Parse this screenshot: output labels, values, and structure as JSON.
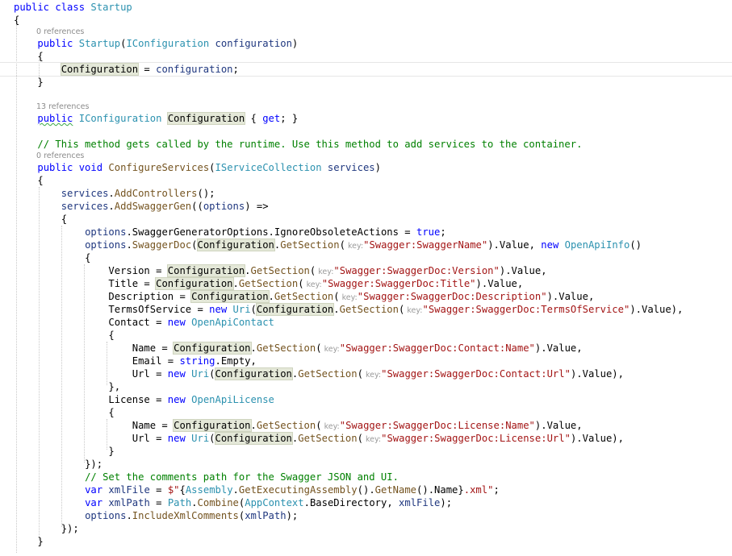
{
  "codelens": {
    "ctor_refs": "0 references",
    "prop_refs": "13 references",
    "method_refs": "0 references"
  },
  "code": {
    "l1_kw": "public class ",
    "l1_type": "Startup",
    "l2": "{",
    "l3_kw": "public ",
    "l3_type": "Startup",
    "l3_p1": "(",
    "l3_ptype": "IConfiguration",
    "l3_pname": " configuration",
    "l3_p2": ")",
    "l4": "{",
    "l5_prop": "Configuration",
    "l5_eq": " = ",
    "l5_var": "configuration",
    "l5_end": ";",
    "l6": "}",
    "l7_kw1": "public",
    "l7_sp": " ",
    "l7_type": "IConfiguration",
    "l7_sp2": " ",
    "l7_prop": "Configuration",
    "l7_b1": " { ",
    "l7_get": "get",
    "l7_b2": "; }",
    "l8_comment": "// This method gets called by the runtime. Use this method to add services to the container.",
    "l9_kw": "public void ",
    "l9_fn": "ConfigureServices",
    "l9_p1": "(",
    "l9_ptype": "IServiceCollection",
    "l9_pname": " services",
    "l9_p2": ")",
    "l10": "{",
    "l11_var": "services",
    "l11_dot": ".",
    "l11_fn": "AddControllers",
    "l11_end": "();",
    "l12_var": "services",
    "l12_dot": ".",
    "l12_fn": "AddSwaggerGen",
    "l12_p": "((",
    "l12_param": "options",
    "l12_end": ") =>",
    "l13": "{",
    "l14_var": "options",
    "l14_a": ".SwaggerGeneratorOptions.IgnoreObsoleteActions = ",
    "l14_true": "true",
    "l14_end": ";",
    "l15_var": "options",
    "l15_dot": ".",
    "l15_fn": "SwaggerDoc",
    "l15_p": "(",
    "l15_prop": "Configuration",
    "l15_dot2": ".",
    "l15_gs": "GetSection",
    "l15_p2": "(",
    "l15_hint": " key:",
    "l15_str": "\"Swagger:SwaggerName\"",
    "l15_mid": ").Value, ",
    "l15_new": "new ",
    "l15_type": "OpenApiInfo",
    "l15_end": "()",
    "l16": "{",
    "l17_a": "Version = ",
    "l17_str": "\"Swagger:SwaggerDoc:Version\"",
    "l18_a": "Title = ",
    "l18_str": "\"Swagger:SwaggerDoc:Title\"",
    "l19_a": "Description = ",
    "l19_str": "\"Swagger:SwaggerDoc:Description\"",
    "l20_a": "TermsOfService = ",
    "l20_uri": "Uri",
    "l20_str": "\"Swagger:SwaggerDoc:TermsOfService\"",
    "l20_end": ").Value),",
    "l21_a": "Contact = ",
    "l21_type": "OpenApiContact",
    "l22": "{",
    "l23_a": "Name = ",
    "l23_str": "\"Swagger:SwaggerDoc:Contact:Name\"",
    "l24_a": "Email = ",
    "l24_kw": "string",
    "l24_end": ".Empty,",
    "l25_a": "Url = ",
    "l25_str": "\"Swagger:SwaggerDoc:Contact:Url\"",
    "l25_end": ").Value),",
    "l26": "},",
    "l27_a": "License = ",
    "l27_type": "OpenApiLicense",
    "l28": "{",
    "l29_a": "Name = ",
    "l29_str": "\"Swagger:SwaggerDoc:License:Name\"",
    "l30_a": "Url = ",
    "l30_str": "\"Swagger:SwaggerDoc:License:Url\"",
    "l30_end": ").Value),",
    "l31": "}",
    "l32": "});",
    "l33_comment": "// Set the comments path for the Swagger JSON and UI.",
    "l34_kw": "var ",
    "l34_var": "xmlFile",
    "l34_eq": " = ",
    "l34_s1": "$\"",
    "l34_brace1": "{",
    "l34_type": "Assembly",
    "l34_dot": ".",
    "l34_fn1": "GetExecutingAssembly",
    "l34_p1": "().",
    "l34_fn2": "GetName",
    "l34_p2": "().Name",
    "l34_brace2": "}",
    "l34_s2": ".xml\"",
    "l34_end": ";",
    "l35_kw": "var ",
    "l35_var": "xmlPath",
    "l35_eq": " = ",
    "l35_type": "Path",
    "l35_dot": ".",
    "l35_fn": "Combine",
    "l35_p": "(",
    "l35_type2": "AppContext",
    "l35_mid": ".BaseDirectory, ",
    "l35_var2": "xmlFile",
    "l35_end": ");",
    "l36_var": "options",
    "l36_dot": ".",
    "l36_fn": "IncludeXmlComments",
    "l36_p": "(",
    "l36_var2": "xmlPath",
    "l36_end": ");",
    "l37": "});",
    "l38": "}",
    "common": {
      "cfg": "Configuration",
      "dot": ".",
      "gs": "GetSection",
      "paren": "(",
      "hint": " key:",
      "value_comma": ").Value,",
      "new": "new ",
      "uri": "Uri"
    }
  }
}
